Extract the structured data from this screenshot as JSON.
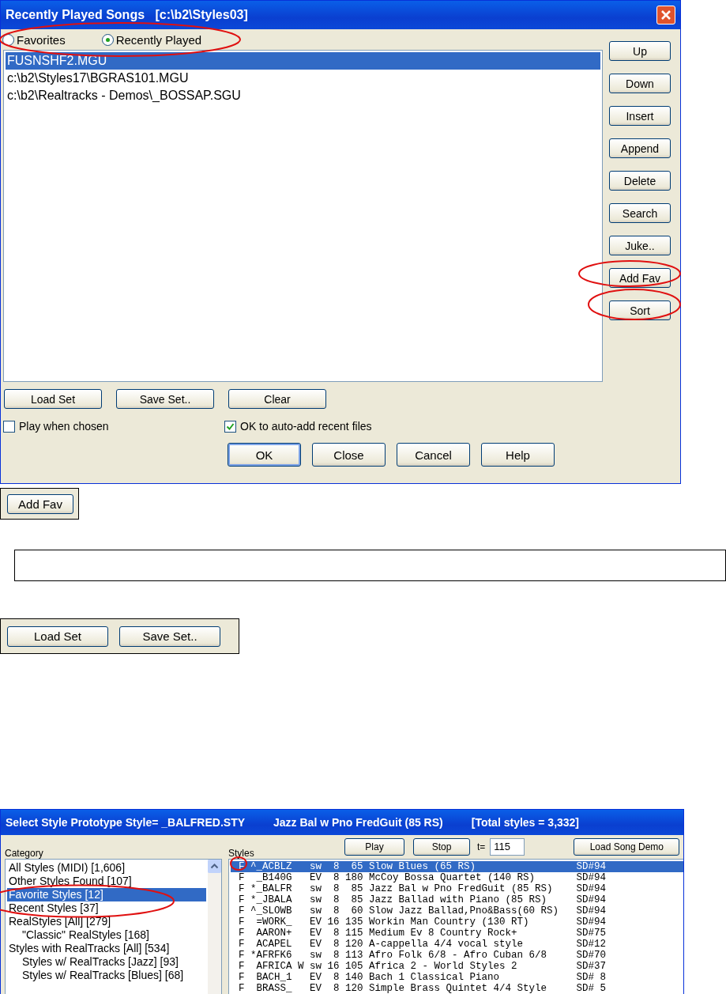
{
  "recent_dialog": {
    "title": "Recently Played Songs   [c:\\b2\\Styles03]",
    "modes": [
      {
        "label": "Favorites",
        "selected": false
      },
      {
        "label": "Recently Played",
        "selected": true
      }
    ],
    "files": [
      {
        "text": "FUSNSHF2.MGU",
        "selected": true
      },
      {
        "text": "c:\\b2\\Styles17\\BGRAS101.MGU",
        "selected": false
      },
      {
        "text": "c:\\b2\\Realtracks - Demos\\_BOSSAP.SGU",
        "selected": false
      }
    ],
    "side_buttons": [
      "Up",
      "Down",
      "Insert",
      "Append",
      "Delete",
      "Search",
      "Juke..",
      "Add Fav",
      "Sort"
    ],
    "set_buttons": [
      "Load Set",
      "Save Set..",
      "Clear"
    ],
    "options": [
      {
        "label": "Play when chosen",
        "checked": false
      },
      {
        "label": "OK to auto-add recent files",
        "checked": true
      }
    ],
    "buttons": [
      {
        "label": "OK",
        "default": true
      },
      {
        "label": "Close",
        "default": false
      },
      {
        "label": "Cancel",
        "default": false
      },
      {
        "label": "Help",
        "default": false
      }
    ]
  },
  "add_fav_detail": {
    "button": "Add Fav"
  },
  "set_detail": {
    "buttons": [
      "Load Set",
      "Save Set.."
    ]
  },
  "style_dialog": {
    "title": "Select Style Prototype Style= _BALFRED.STY",
    "current": "Jazz Bal w Pno FredGuit (85 RS)",
    "total": "[Total styles = 3,332]",
    "category_label": "Category",
    "styles_label": "Styles",
    "toolbar": {
      "play": "Play",
      "stop": "Stop",
      "tempo_label": "t=",
      "tempo": "115",
      "demo": "Load Song Demo"
    },
    "categories": [
      {
        "text": "All Styles (MIDI) [1,606]",
        "selected": false
      },
      {
        "text": "Other Styles Found [107]",
        "selected": false
      },
      {
        "text": "Favorite Styles [12]",
        "selected": true
      },
      {
        "text": "Recent Styles [37]",
        "selected": false
      },
      {
        "text": "RealStyles [All] [279]",
        "selected": false,
        "children": [
          {
            "text": "\"Classic\" RealStyles [168]",
            "selected": false
          }
        ]
      },
      {
        "text": "Styles with RealTracks [All] [534]",
        "selected": false,
        "children": [
          {
            "text": "Styles w/ RealTracks [Jazz] [93]",
            "selected": false
          },
          {
            "text": "Styles w/ RealTracks [Blues] [68]",
            "selected": false
          }
        ]
      }
    ],
    "styles": [
      {
        "text": "F ^_ACBLZ   sw  8  65 Slow Blues (65 RS)                 SD#94",
        "selected": true
      },
      {
        "text": "F  _B140G   EV  8 180 McCoy Bossa Quartet (140 RS)       SD#94",
        "selected": false
      },
      {
        "text": "F *_BALFR   sw  8  85 Jazz Bal w Pno FredGuit (85 RS)    SD#94",
        "selected": false
      },
      {
        "text": "F *_JBALA   sw  8  85 Jazz Ballad with Piano (85 RS)     SD#94",
        "selected": false
      },
      {
        "text": "F ^_SLOWB   sw  8  60 Slow Jazz Ballad,Pno&Bass(60 RS)   SD#94",
        "selected": false
      },
      {
        "text": "F  =WORK_   EV 16 135 Workin Man Country (130 RT)        SD#94",
        "selected": false
      },
      {
        "text": "F  AARON+   EV  8 115 Medium Ev 8 Country Rock+          SD#75",
        "selected": false
      },
      {
        "text": "F  ACAPEL   EV  8 120 A-cappella 4/4 vocal style         SD#12",
        "selected": false
      },
      {
        "text": "F *AFRFK6   sw  8 113 Afro Folk 6/8 - Afro Cuban 6/8     SD#70",
        "selected": false
      },
      {
        "text": "F  AFRICA W sw 16 105 Africa 2 - World Styles 2          SD#37",
        "selected": false
      },
      {
        "text": "F  BACH_1   EV  8 140 Bach 1 Classical Piano             SD# 8",
        "selected": false
      },
      {
        "text": "F  BRASS_   EV  8 120 Simple Brass Quintet 4/4 Style     SD# 5",
        "selected": false
      }
    ]
  }
}
